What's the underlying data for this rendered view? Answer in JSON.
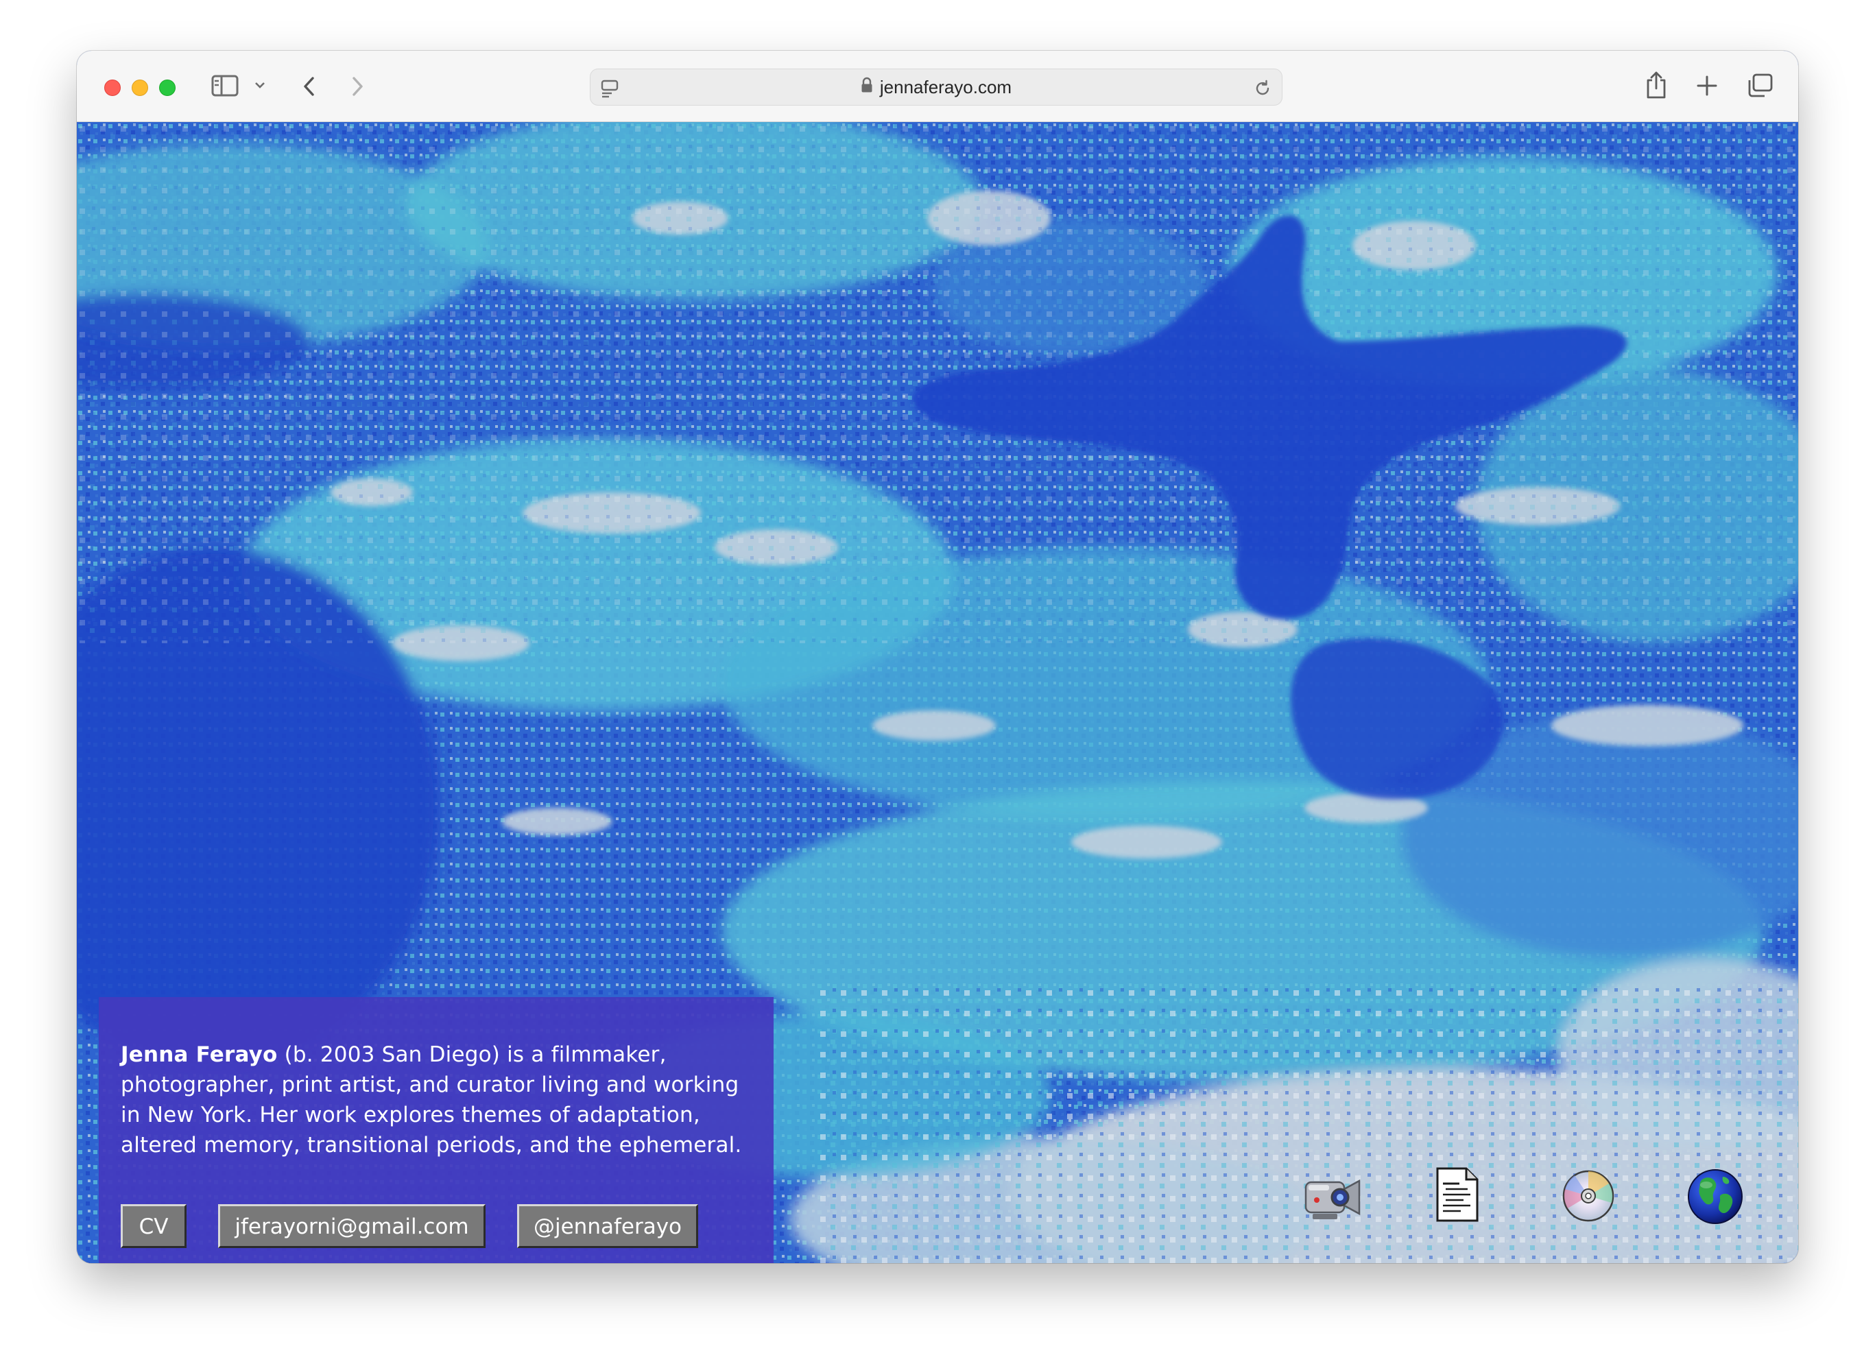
{
  "browser": {
    "url": "jennaferayo.com"
  },
  "bio": {
    "name": "Jenna Ferayo",
    "text": " (b. 2003 San Diego) is a filmmaker, photographer, print artist, and curator living and working in New York. Her work explores themes of adaptation, altered memory, transitional periods, and the ephemeral."
  },
  "links": {
    "cv": "CV",
    "email": "jferayorni@gmail.com",
    "instagram": "@jennaferayo"
  },
  "desktop_icons": [
    "camcorder-icon",
    "document-icon",
    "cd-icon",
    "globe-icon"
  ],
  "colors": {
    "bio_box": "#443abe",
    "button": "#797979",
    "background_dark_blue": "#2248c8",
    "background_cyan": "#55bfd8",
    "background_light": "#c8d6e4"
  }
}
